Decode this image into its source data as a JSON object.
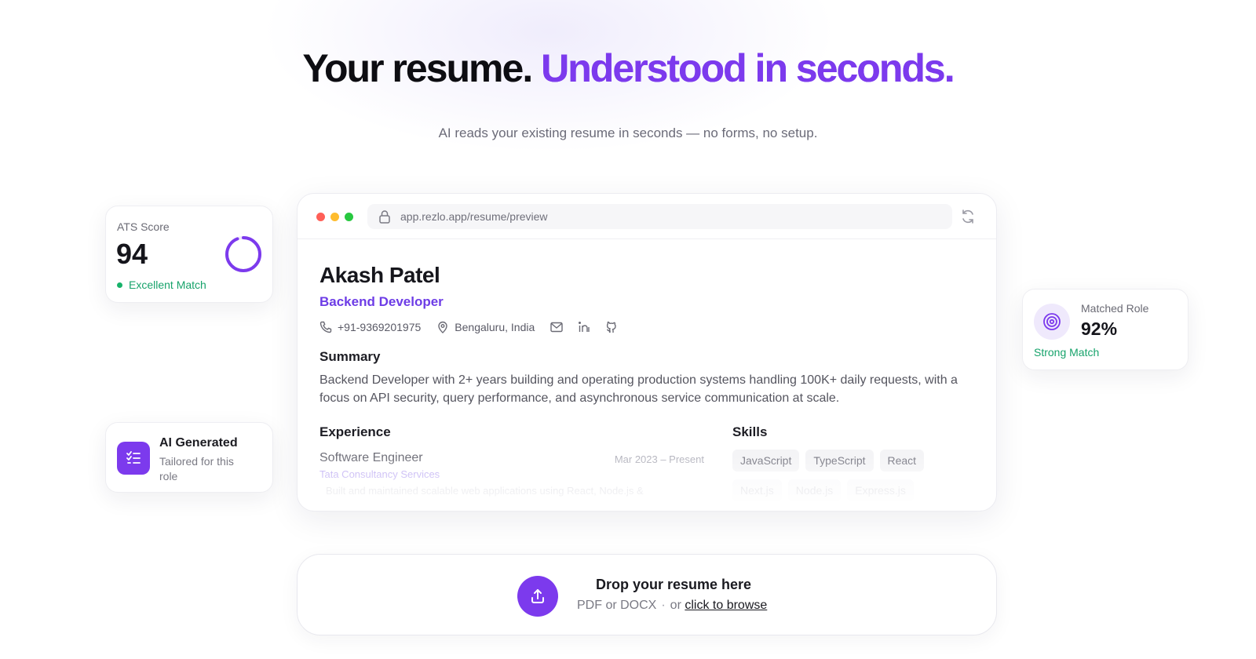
{
  "hero": {
    "title_part1": "Your resume.",
    "title_part2": "Understood in seconds.",
    "subtitle": "AI reads your existing resume in seconds — no forms, no setup."
  },
  "browser": {
    "url": "app.rezlo.app/resume/preview"
  },
  "resume": {
    "name": "Akash Patel",
    "role": "Backend Developer",
    "phone": "+91-9369201975",
    "location": "Bengaluru, India",
    "summary_heading": "Summary",
    "summary": "Backend Developer with 2+ years building and operating production systems handling 100K+ daily requests, with a focus on API security, query performance, and asynchronous service communication at scale.",
    "experience_heading": "Experience",
    "experience": {
      "title": "Software Engineer",
      "dates": "Mar 2023 – Present",
      "company": "Tata Consultancy Services",
      "description": "Built and maintained scalable web applications using React, Node.js &"
    },
    "skills_heading": "Skills",
    "skills": [
      "JavaScript",
      "TypeScript",
      "React",
      "Next.js",
      "Node.js",
      "Express.js"
    ]
  },
  "ats_card": {
    "label": "ATS Score",
    "value": "94",
    "status": "Excellent Match",
    "progress_fraction": 0.94
  },
  "ai_card": {
    "title": "AI Generated",
    "subtitle": "Tailored for this role"
  },
  "role_card": {
    "label": "Matched Role",
    "value": "92%",
    "status": "Strong Match"
  },
  "dropzone": {
    "title": "Drop your resume here",
    "formats": "PDF or DOCX",
    "separator": "·",
    "or_text": "or",
    "browse_link": "click to browse"
  },
  "colors": {
    "accent": "#7c3aed",
    "success": "#17a36b"
  }
}
